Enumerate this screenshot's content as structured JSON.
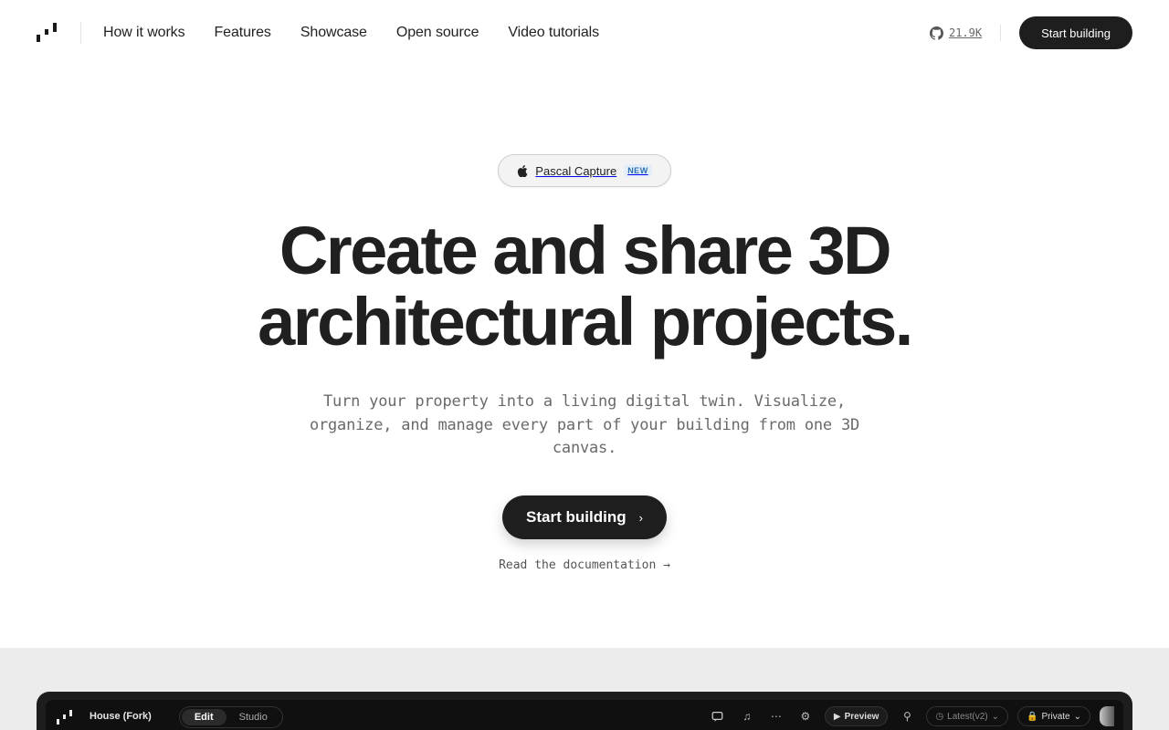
{
  "header": {
    "nav": [
      "How it works",
      "Features",
      "Showcase",
      "Open source",
      "Video tutorials"
    ],
    "github_stars": "21.9K",
    "cta_label": "Start building"
  },
  "hero": {
    "pill_label": "Pascal Capture",
    "pill_badge": "NEW",
    "title_line1": "Create and share 3D",
    "title_line2": "architectural projects.",
    "subtitle": "Turn your property into a living digital twin. Visualize, organize, and manage every part of your building from one 3D canvas.",
    "cta_label": "Start building",
    "cta_icon": "chevron-right-icon",
    "docs_link": "Read the documentation →"
  },
  "app_preview": {
    "project_name": "House (Fork)",
    "modes": [
      "Edit",
      "Studio"
    ],
    "active_mode": "Edit",
    "preview_label": "Preview",
    "version_label": "Latest(v2)",
    "visibility_label": "Private"
  },
  "colors": {
    "primary_dark": "#1e1e1e",
    "badge_text": "#2a6fb0",
    "badge_bg": "#e3eefa",
    "band_bg": "#ececec"
  }
}
